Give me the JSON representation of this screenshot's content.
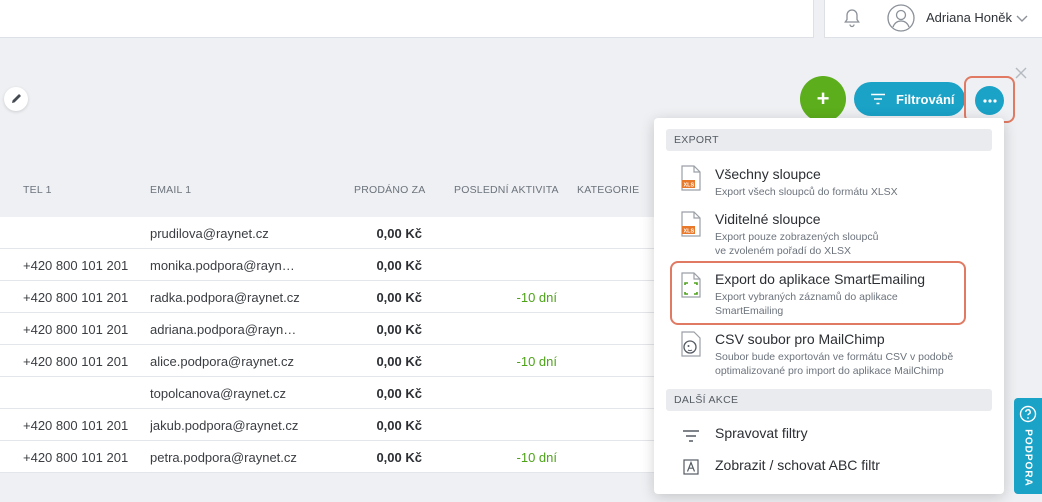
{
  "header": {
    "user_name": "Adriana Honěk"
  },
  "toolbar": {
    "add_label": "+",
    "filter_label": "Filtrování"
  },
  "table": {
    "headers": {
      "tel": "TEL 1",
      "email": "EMAIL 1",
      "sold": "PRODÁNO ZA",
      "last_activity": "POSLEDNÍ AKTIVITA",
      "category": "KATEGORIE"
    },
    "rows": [
      {
        "tel": "",
        "email": "prudilova@raynet.cz",
        "sold": "0,00 Kč",
        "activity": ""
      },
      {
        "tel": "+420 800 101 201",
        "email": "monika.podpora@rayne…",
        "sold": "0,00 Kč",
        "activity": ""
      },
      {
        "tel": "+420 800 101 201",
        "email": "radka.podpora@raynet.cz",
        "sold": "0,00 Kč",
        "activity": "-10 dní"
      },
      {
        "tel": "+420 800 101 201",
        "email": "adriana.podpora@rayne…",
        "sold": "0,00 Kč",
        "activity": ""
      },
      {
        "tel": "+420 800 101 201",
        "email": "alice.podpora@raynet.cz",
        "sold": "0,00 Kč",
        "activity": "-10 dní"
      },
      {
        "tel": "",
        "email": "topolcanova@raynet.cz",
        "sold": "0,00 Kč",
        "activity": ""
      },
      {
        "tel": "+420 800 101 201",
        "email": "jakub.podpora@raynet.cz",
        "sold": "0,00 Kč",
        "activity": ""
      },
      {
        "tel": "+420 800 101 201",
        "email": "petra.podpora@raynet.cz",
        "sold": "0,00 Kč",
        "activity": "-10 dní"
      }
    ]
  },
  "menu": {
    "export_section": "EXPORT",
    "all_columns": {
      "title": "Všechny sloupce",
      "desc": "Export všech sloupců do formátu XLSX",
      "icon": "xls-file-icon"
    },
    "visible_columns": {
      "title": "Viditelné sloupce",
      "desc_line1": "Export pouze zobrazených sloupců",
      "desc_line2": "ve zvoleném pořadí do XLSX",
      "icon": "xls-file-icon"
    },
    "smartemailing": {
      "title": "Export do aplikace SmartEmailing",
      "desc_line1": "Export vybraných záznamů do aplikace",
      "desc_line2": "SmartEmailing",
      "icon": "smartemailing-file-icon"
    },
    "mailchimp": {
      "title": "CSV soubor pro MailChimp",
      "desc_line1": "Soubor bude exportován ve formátu CSV v podobě",
      "desc_line2": "optimalizované pro import do aplikace MailChimp",
      "icon": "mailchimp-icon"
    },
    "other_section": "DALŠÍ AKCE",
    "manage_filters": {
      "title": "Spravovat filtry",
      "icon": "filter-lines-icon"
    },
    "abc_filter": {
      "title": "Zobrazit / schovat ABC filtr",
      "icon": "abc-filter-icon"
    },
    "xls_badge": "XLS"
  },
  "support": {
    "label": "PODPORA"
  },
  "colors": {
    "accent_blue": "#1aa2c7",
    "add_green": "#5cae1c",
    "highlight": "#e07a63",
    "activity_green": "#4ea21a"
  }
}
